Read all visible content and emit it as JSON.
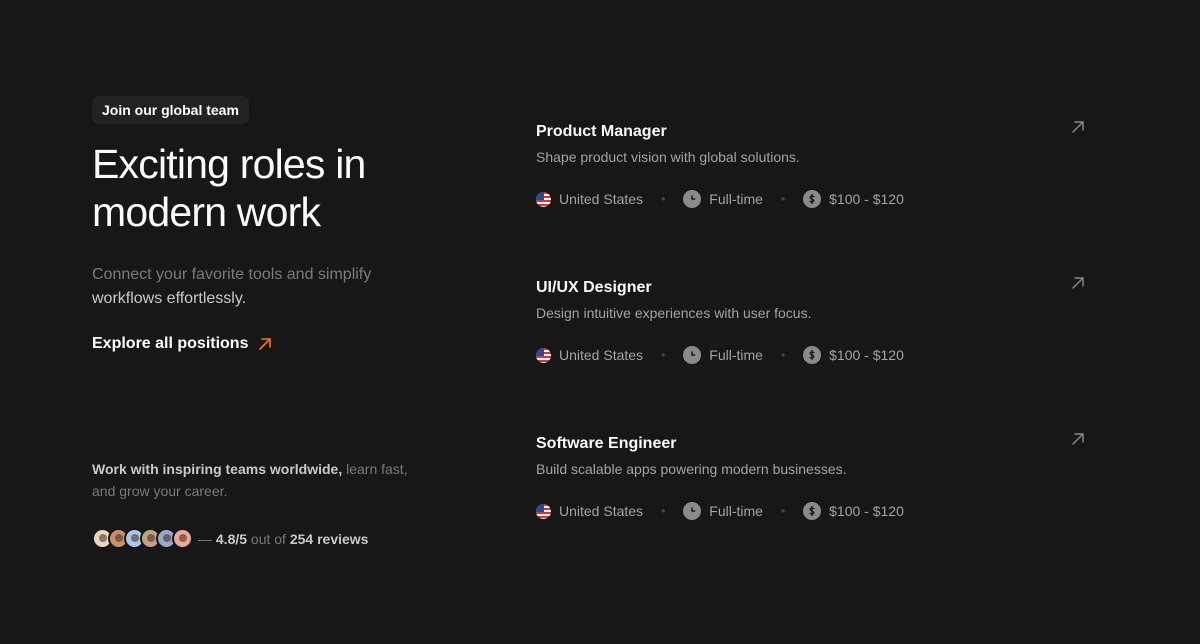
{
  "hero": {
    "badge": "Join our global team",
    "headline_line1": "Exciting roles in",
    "headline_line2": "modern work",
    "subtitle_part1": "Connect your favorite tools and simplify",
    "subtitle_part2": "workflows effortlessly.",
    "explore_label": "Explore all positions",
    "accent_color": "#f97316"
  },
  "social_proof": {
    "text_highlight": "Work with inspiring teams worldwide,",
    "text_rest": " learn fast, and grow your career.",
    "dash": "—",
    "rating": "4.8/5",
    "out_of": " out of ",
    "reviews": "254 reviews",
    "avatar_colors": [
      "#e8d6c4",
      "#c98f6e",
      "#a8c8e8",
      "#c4a186",
      "#9aa9c9",
      "#e8a89a"
    ]
  },
  "jobs": [
    {
      "title": "Product Manager",
      "description": "Shape product vision with global solutions.",
      "location": "United States",
      "type": "Full-time",
      "salary": "$100 - $120"
    },
    {
      "title": "UI/UX Designer",
      "description": "Design intuitive experiences with user focus.",
      "location": "United States",
      "type": "Full-time",
      "salary": "$100 - $120"
    },
    {
      "title": "Software Engineer",
      "description": "Build scalable apps powering modern businesses.",
      "location": "United States",
      "type": "Full-time",
      "salary": "$100 - $120"
    }
  ]
}
